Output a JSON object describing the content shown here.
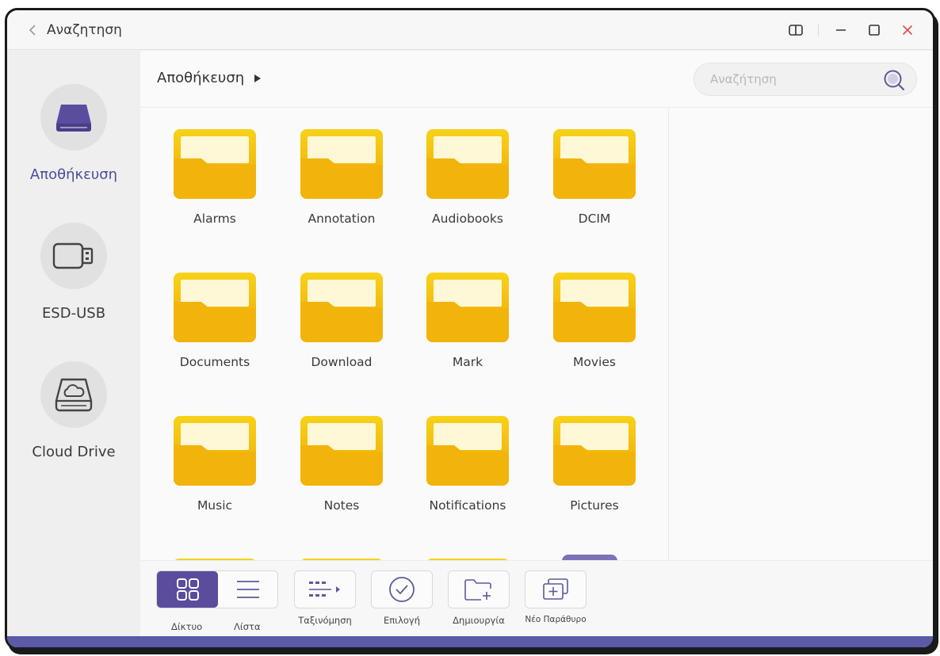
{
  "titlebar": {
    "title": "Αναζητηση"
  },
  "sidebar": {
    "items": [
      {
        "label": "Αποθήκευση",
        "icon": "drive-icon",
        "active": true
      },
      {
        "label": "ESD-USB",
        "icon": "usb-icon",
        "active": false
      },
      {
        "label": "Cloud Drive",
        "icon": "cloud-drive-icon",
        "active": false
      }
    ]
  },
  "main": {
    "breadcrumb": "Αποθήκευση",
    "search_placeholder": "Αναζήτηση",
    "folders": [
      "Alarms",
      "Annotation",
      "Audiobooks",
      "DCIM",
      "Documents",
      "Download",
      "Mark",
      "Movies",
      "Music",
      "Notes",
      "Notifications",
      "Pictures"
    ]
  },
  "toolbar": {
    "grid_label": "Δίκτυο",
    "list_label": "Λίστα",
    "sort_label": "Ταξινόμηση",
    "select_label": "Επιλογή",
    "create_label": "Δημιουργία",
    "new_window_label": "Νέο Παράθυρο"
  },
  "colors": {
    "accent": "#5b4c9e",
    "folder_yellow": "#f5c400",
    "folder_orange": "#f0a800",
    "close_red": "#e0524f"
  }
}
